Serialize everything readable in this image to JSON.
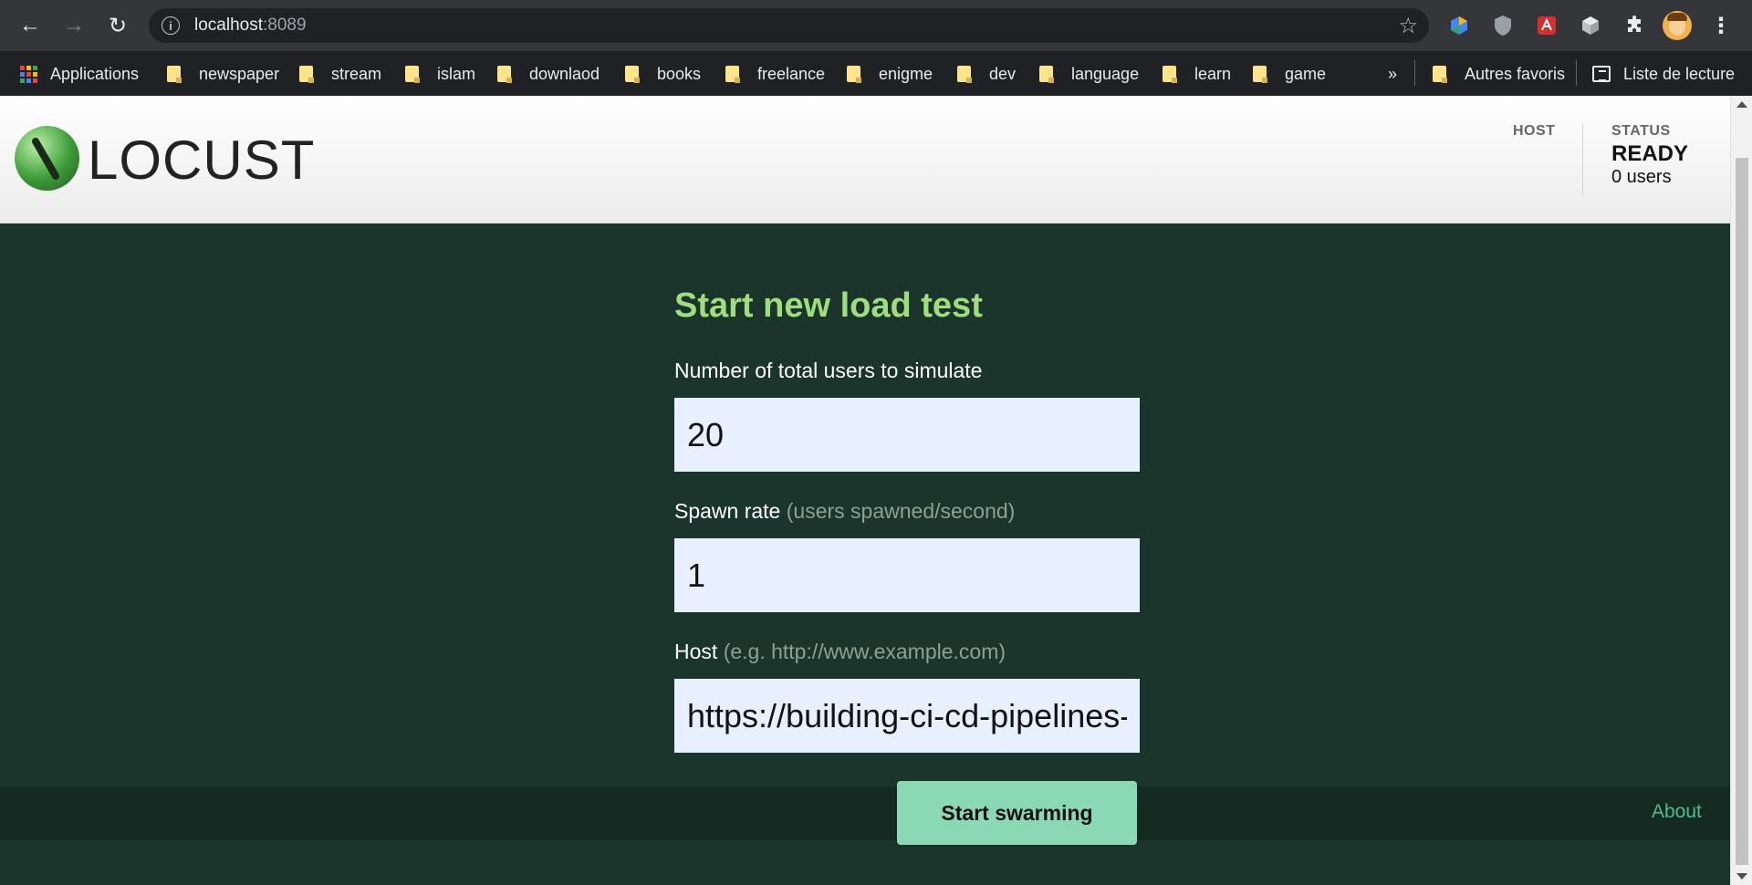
{
  "browser": {
    "url_host": "localhost",
    "url_port": ":8089",
    "bookmarks": [
      {
        "label": "Applications"
      },
      {
        "label": "newspaper"
      },
      {
        "label": "stream"
      },
      {
        "label": "islam"
      },
      {
        "label": "downlaod"
      },
      {
        "label": "books"
      },
      {
        "label": "freelance"
      },
      {
        "label": "enigme"
      },
      {
        "label": "dev"
      },
      {
        "label": "language"
      },
      {
        "label": "learn"
      },
      {
        "label": "game"
      }
    ],
    "more_bookmarks": "»",
    "other_bookmarks": "Autres favoris",
    "reading_list": "Liste de lecture",
    "icons": {
      "back": "arrow-back-icon",
      "forward": "arrow-forward-icon",
      "reload": "reload-icon",
      "site_info": "info-icon",
      "bookmark": "star-icon",
      "extensions": "puzzle-icon",
      "menu": "kebab-menu-icon"
    }
  },
  "header": {
    "logo_text": "LOCUST",
    "host_label": "HOST",
    "status_label": "STATUS",
    "status_value": "READY",
    "users": "0 users"
  },
  "form": {
    "title": "Start new load test",
    "users_label": "Number of total users to simulate",
    "users_value": "20",
    "spawn_label": "Spawn rate",
    "spawn_hint": "(users spawned/second)",
    "spawn_value": "1",
    "host_label": "Host",
    "host_hint": "(e.g. http://www.example.com)",
    "host_value": "https://building-ci-cd-pipelines-a",
    "submit_label": "Start swarming"
  },
  "footer": {
    "about": "About"
  },
  "colors": {
    "page_background": "#1b352c",
    "title_green": "#9fde7d",
    "button_green": "#8ad8b4",
    "input_background": "#e8f0fe",
    "about_link": "#4dbc92"
  }
}
